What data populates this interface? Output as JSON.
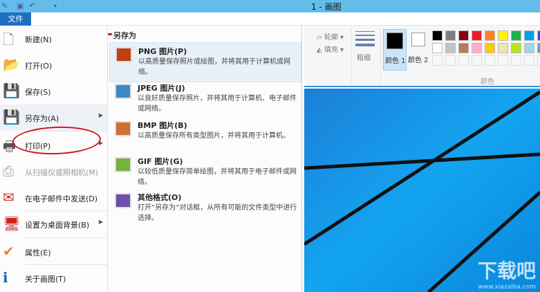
{
  "window": {
    "title": "1 - 画图"
  },
  "ribbon_tabs": {
    "file": "文件"
  },
  "ribbon": {
    "outline": "轮廓",
    "fill": "填充",
    "size": "粗细",
    "color1": "颜色 1",
    "color2": "颜色 2",
    "colors_group": "颜色",
    "palette_row1": [
      "#000000",
      "#7f7f7f",
      "#880015",
      "#ed1c24",
      "#ff7f27",
      "#fff200",
      "#22b14c",
      "#00a2e8",
      "#3f48cc"
    ],
    "palette_row2": [
      "#ffffff",
      "#c3c3c3",
      "#b97a57",
      "#ffaec9",
      "#ffc90e",
      "#efe4b0",
      "#b5e61d",
      "#99d9ea",
      "#7092be"
    ]
  },
  "file_menu": {
    "items": [
      {
        "label": "新建(N)"
      },
      {
        "label": "打开(O)"
      },
      {
        "label": "保存(S)"
      },
      {
        "label": "另存为(A)"
      },
      {
        "label": "打印(P)"
      },
      {
        "label": "从扫描仪或照相机(M)"
      },
      {
        "label": "在电子邮件中发送(D)"
      },
      {
        "label": "设置为桌面背景(B)"
      },
      {
        "label": "属性(E)"
      },
      {
        "label": "关于画图(T)"
      }
    ]
  },
  "save_as_submenu": {
    "header": "另存为",
    "items": [
      {
        "title": "PNG 图片(P)",
        "desc": "以高质量保存照片或绘图，并将其用于计算机或网络。"
      },
      {
        "title": "JPEG 图片(J)",
        "desc": "以良好质量保存照片，并将其用于计算机、电子邮件或网络。"
      },
      {
        "title": "BMP 图片(B)",
        "desc": "以高质量保存所有类型图片，并将其用于计算机。"
      },
      {
        "title": "GIF 图片(G)",
        "desc": "以较低质量保存简单绘图，并将其用于电子邮件或网络。"
      },
      {
        "title": "其他格式(O)",
        "desc": "打开“另存为”对话框，从所有可能的文件类型中进行选择。"
      }
    ]
  },
  "watermark": {
    "text": "下载吧",
    "url": "www.xiazaiba.com"
  }
}
